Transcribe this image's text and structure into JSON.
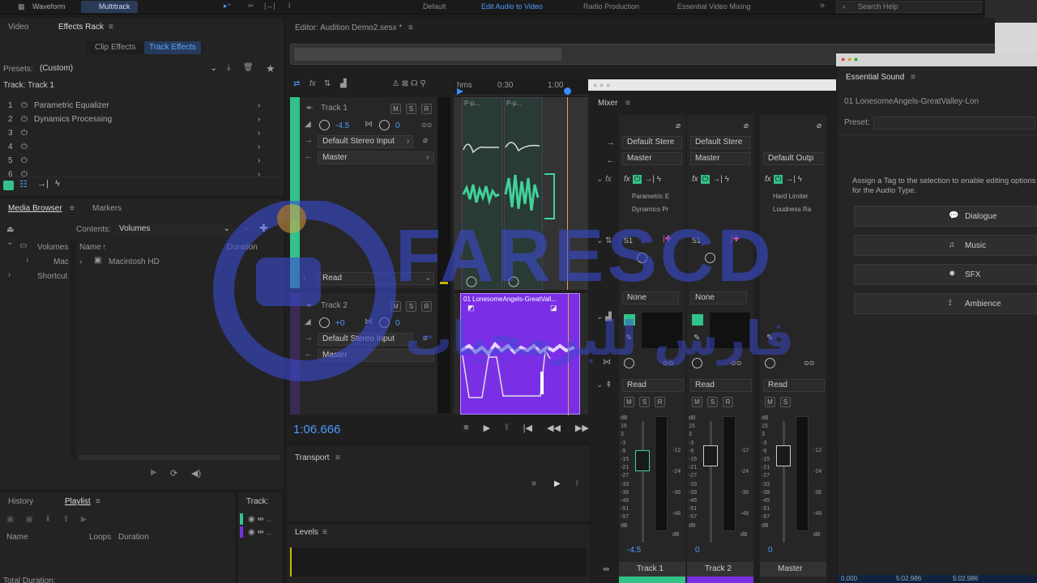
{
  "menubar": {
    "waveform": "Waveform",
    "multitrack": "Multitrack",
    "workspaces": [
      "Default",
      "Edit Audio to Video",
      "Radio Production",
      "Essential Video Mixing"
    ],
    "more": "»",
    "search": "Search Help"
  },
  "left": {
    "tabs": [
      "Video",
      "Effects Rack"
    ],
    "subtabs": [
      "Clip Effects",
      "Track Effects"
    ],
    "presets_label": "Presets:",
    "presets_value": "(Custom)",
    "track_label": "Track: Track 1",
    "effects": [
      {
        "n": "1",
        "name": "Parametric Equalizer"
      },
      {
        "n": "2",
        "name": "Dynamics Processing"
      },
      {
        "n": "3",
        "name": ""
      },
      {
        "n": "4",
        "name": ""
      },
      {
        "n": "5",
        "name": ""
      },
      {
        "n": "6",
        "name": ""
      }
    ]
  },
  "browser": {
    "tabs": [
      "Media Browser",
      "Markers"
    ],
    "contents_label": "Contents:",
    "contents_value": "Volumes",
    "col_name": "Name",
    "col_duration": "Duration",
    "tree": [
      "Volumes",
      "Mac",
      "Shortcut"
    ],
    "items": [
      "Macintosh HD"
    ]
  },
  "history": {
    "tabs": [
      "History",
      "Playlist"
    ],
    "cols": [
      "Name",
      "Loops",
      "Duration"
    ],
    "total": "Total Duration:",
    "track_label": "Track:"
  },
  "editor": {
    "title": "Editor: Audition Demo2.sesx *",
    "ruler": [
      "hms",
      "0:30",
      "1:00"
    ],
    "track1": {
      "name": "Track 1",
      "vol": "-4.5",
      "pan": "0",
      "input": "Default Stereo Input",
      "output": "Master",
      "mode": "Read"
    },
    "track2": {
      "name": "Track 2",
      "vol": "+0",
      "pan": "0",
      "input": "Default Stereo Input",
      "output": "Master"
    },
    "clip_labels": [
      "P-p...",
      "P-p..."
    ],
    "clip2_name": "01 LonesomeAngels-GreatVall...",
    "time": "1:06.666",
    "transport": "Transport",
    "levels": "Levels"
  },
  "mixer": {
    "title": "Mixer",
    "channels": [
      {
        "in": "Default Stere",
        "out": "Master",
        "fx": [
          "Parametric E",
          "Dynamics Pr"
        ],
        "send": "S1",
        "none": "None",
        "mode": "Read",
        "vol": "-4.5",
        "name": "Track 1"
      },
      {
        "in": "Default Stere",
        "out": "Master",
        "fx": [],
        "send": "S1",
        "none": "None",
        "mode": "Read",
        "vol": "0",
        "name": "Track 2"
      },
      {
        "in": "",
        "out": "Default Outp",
        "fx": [
          "Hard Limiter",
          "Loudness Ra"
        ],
        "send": "",
        "none": "",
        "mode": "Read",
        "vol": "0",
        "name": "Master"
      }
    ],
    "db_scale": [
      "dB",
      "15",
      "3",
      "-3",
      "-9",
      "-15",
      "-21",
      "-27",
      "-33",
      "-39",
      "-45",
      "-51",
      "-57",
      "dB"
    ],
    "meter_scale": [
      "-12",
      "-24",
      "-36",
      "-48",
      "dB"
    ]
  },
  "essential": {
    "title": "Essential Sound",
    "file": "01 LonesomeAngels-GreatValley-Lon",
    "preset_label": "Preset:",
    "hint": "Assign a Tag to the selection to enable editing options for the Audio Type.",
    "types": [
      "Dialogue",
      "Music",
      "SFX",
      "Ambience"
    ],
    "bottom": [
      "0.000",
      "5:02.986",
      "5:02.986"
    ]
  },
  "watermark": {
    "latin": "FARESCD",
    "arabic": "فارس للبرمجيات"
  },
  "colors": {
    "accent": "#3d8bff",
    "green": "#32c28a",
    "purple": "#7a2fe6",
    "orange": "#e8a33d"
  }
}
